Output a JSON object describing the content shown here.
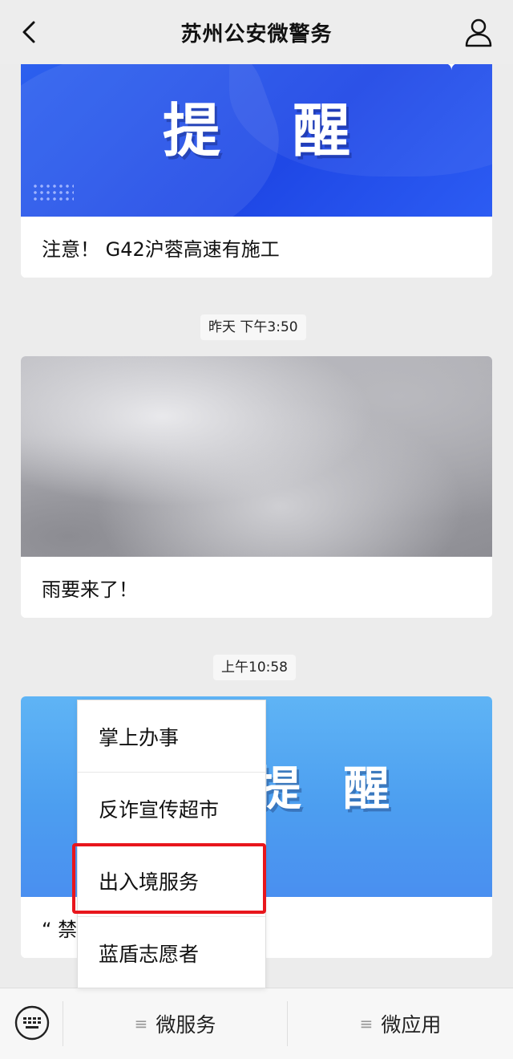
{
  "header": {
    "title": "苏州公安微警务",
    "back_icon": "chevron-left-icon",
    "user_icon": "user-profile-icon"
  },
  "messages": [
    {
      "banner_text": "提醒",
      "caption": "注意！ G42沪蓉高速有施工"
    },
    {
      "timestamp": "昨天 下午3:50",
      "caption": "雨要来了！"
    },
    {
      "timestamp": "上午10:58",
      "banner_text": "提 醒",
      "caption": "“ 禁"
    }
  ],
  "popup_menu": {
    "items": [
      "掌上办事",
      "反诈宣传超市",
      "出入境服务",
      "蓝盾志愿者"
    ],
    "highlighted_index": 2,
    "highlight_color": "#e8161c"
  },
  "bottom_bar": {
    "keyboard_icon": "keyboard-icon",
    "menus": [
      {
        "lines": "≡",
        "label": "微服务"
      },
      {
        "lines": "≡",
        "label": "微应用"
      }
    ]
  },
  "colors": {
    "banner_blue": "#2453ea",
    "banner_light_blue": "#4c9ef0",
    "highlight_red": "#e8161c"
  }
}
